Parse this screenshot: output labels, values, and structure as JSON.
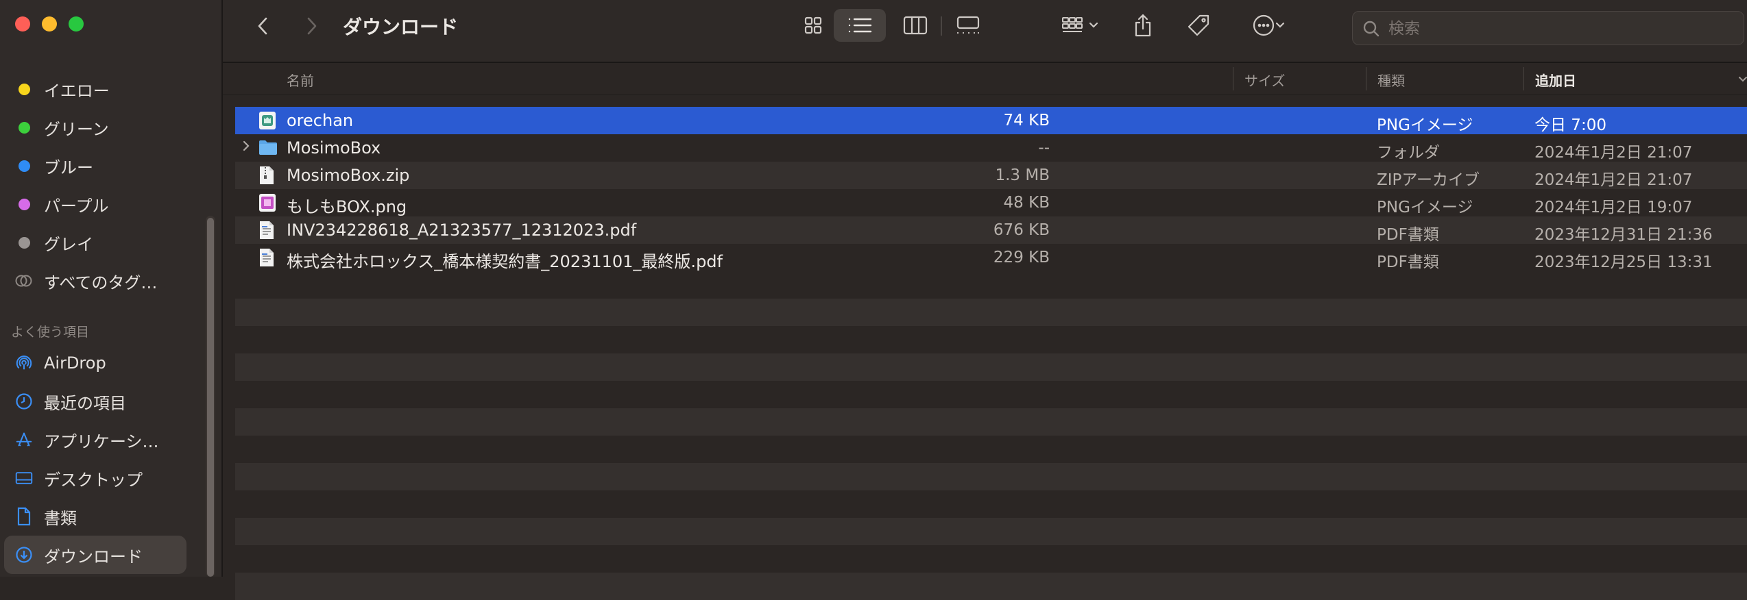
{
  "window": {
    "title": "ダウンロード"
  },
  "sidebar": {
    "tags": [
      {
        "label": "イエロー",
        "color": "#f7d51c"
      },
      {
        "label": "グリーン",
        "color": "#3ccf3c"
      },
      {
        "label": "ブルー",
        "color": "#2f8cf5"
      },
      {
        "label": "パープル",
        "color": "#d66be8"
      },
      {
        "label": "グレイ",
        "color": "#9a9593"
      },
      {
        "label": "すべてのタグ…",
        "color": ""
      }
    ],
    "favorites_heading": "よく使う項目",
    "favorites": [
      {
        "label": "AirDrop",
        "icon": "airdrop-icon"
      },
      {
        "label": "最近の項目",
        "icon": "clock-icon"
      },
      {
        "label": "アプリケーシ…",
        "icon": "applications-icon"
      },
      {
        "label": "デスクトップ",
        "icon": "desktop-icon"
      },
      {
        "label": "書類",
        "icon": "document-icon"
      },
      {
        "label": "ダウンロード",
        "icon": "download-icon"
      }
    ]
  },
  "toolbar": {
    "search_placeholder": "検索"
  },
  "columns": {
    "name": "名前",
    "size": "サイズ",
    "kind": "種類",
    "date_added": "追加日"
  },
  "files": [
    {
      "name": "orechan",
      "size": "74 KB",
      "kind": "PNGイメージ",
      "date": "今日 7:00",
      "icon": "image-icon",
      "selected": true
    },
    {
      "name": "MosimoBox",
      "size": "--",
      "kind": "フォルダ",
      "date": "2024年1月2日 21:07",
      "icon": "folder-icon",
      "selected": false
    },
    {
      "name": "MosimoBox.zip",
      "size": "1.3 MB",
      "kind": "ZIPアーカイブ",
      "date": "2024年1月2日 21:07",
      "icon": "zip-icon",
      "selected": false
    },
    {
      "name": "もしもBOX.png",
      "size": "48 KB",
      "kind": "PNGイメージ",
      "date": "2024年1月2日 19:07",
      "icon": "image-icon",
      "selected": false
    },
    {
      "name": "INV234228618_A21323577_12312023.pdf",
      "size": "676 KB",
      "kind": "PDF書類",
      "date": "2023年12月31日 21:36",
      "icon": "pdf-icon",
      "selected": false
    },
    {
      "name": "株式会社ホロックス_橋本様契約書_20231101_最終版.pdf",
      "size": "229 KB",
      "kind": "PDF書類",
      "date": "2023年12月25日 13:31",
      "icon": "pdf-icon",
      "selected": false
    }
  ],
  "colors": {
    "accent": "#2b5bd2",
    "background": "#2b2624"
  }
}
